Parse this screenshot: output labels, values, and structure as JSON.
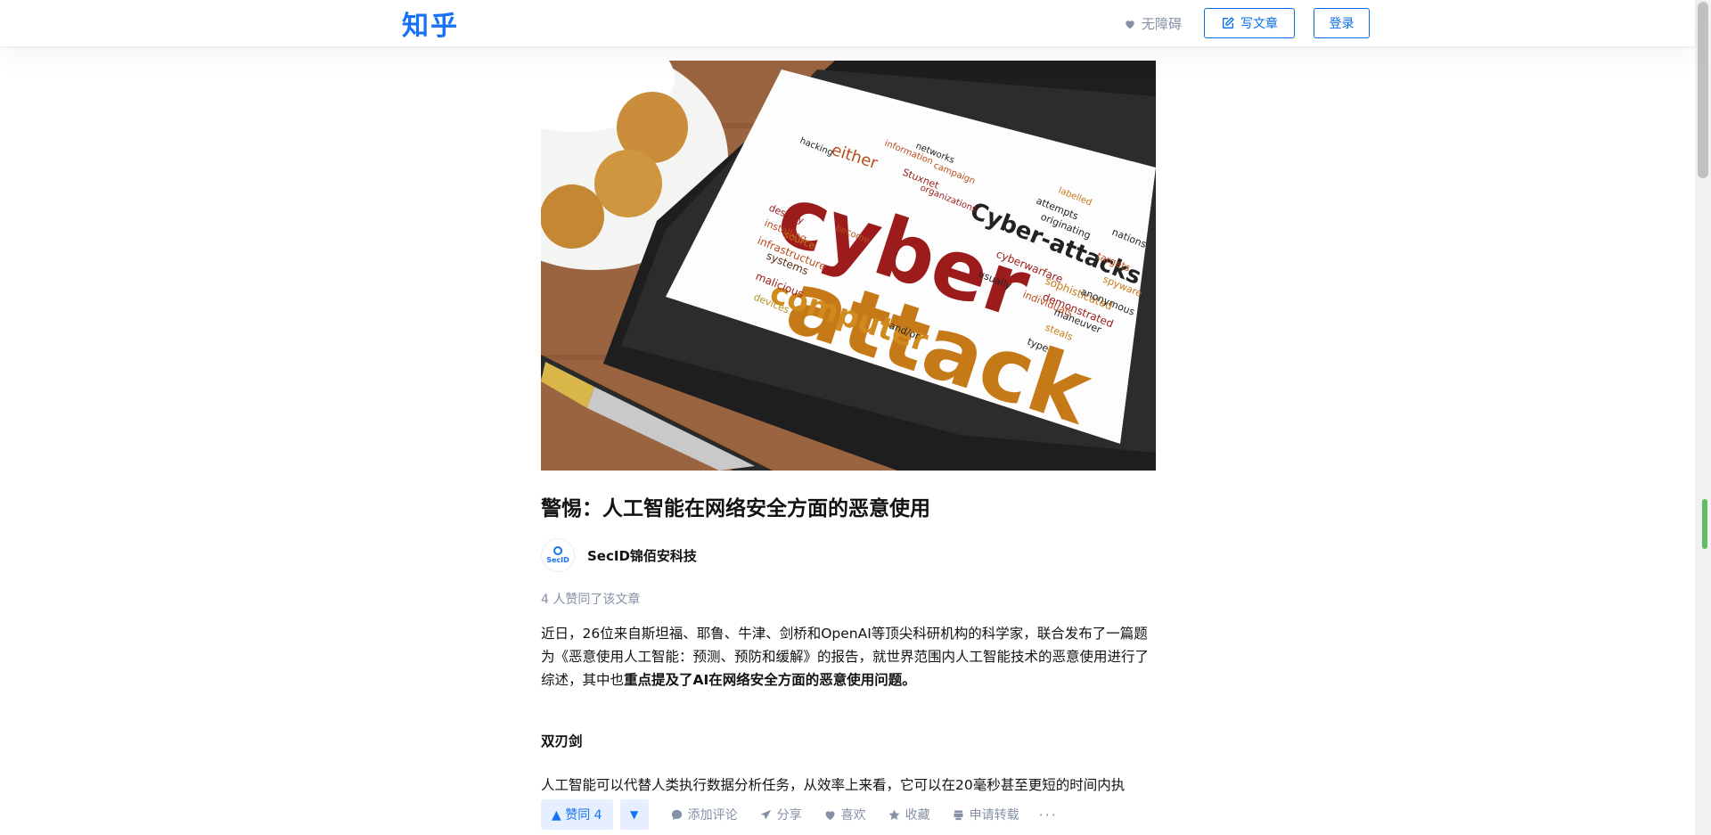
{
  "header": {
    "logo": "知乎",
    "accessibility": "无障碍",
    "write_label": "写文章",
    "login_label": "登录"
  },
  "article": {
    "image_words": {
      "main1": "cyber",
      "main2": "attack",
      "w_computer": "computer",
      "w_cyberattacks": "Cyber-attacks",
      "w_either": "either",
      "w_malicious": "malicious",
      "w_devices": "devices",
      "w_systems": "systems",
      "w_infrastructure": "infrastructure",
      "w_cyberwarfare": "cyberwarfare",
      "w_sophisticated": "sophisticated",
      "w_demonstrated": "demonstrated",
      "w_anonymous": "anonymous",
      "w_spyware": "spyware",
      "w_targets": "targets",
      "w_nations": "nations",
      "w_steals": "steals",
      "w_type": "type",
      "w_andor": "and/or",
      "w_usually": "usually",
      "w_hacking": "hacking",
      "w_information": "information",
      "w_networks": "networks",
      "w_destroy": "destroy",
      "w_installing": "installing",
      "w_maneuver": "maneuver",
      "w_individuals": "individuals",
      "w_attempts": "attempts",
      "w_originating": "originating",
      "w_labelled": "labelled",
      "w_campaign": "campaign",
      "w_stuxnet": "Stuxnet",
      "w_organizations": "organizations",
      "w_become": "become",
      "w_source": "source"
    },
    "title": "警惕：人工智能在网络安全方面的恶意使用",
    "author_name": "SecID锦佰安科技",
    "avatar_text": "SecID",
    "votes_line": "4 人赞同了该文章",
    "para1_normal": "近日，26位来自斯坦福、耶鲁、牛津、剑桥和OpenAI等顶尖科研机构的科学家，联合发布了一篇题为《恶意使用人工智能：预测、预防和缓解》的报告，就世界范围内人工智能技术的恶意使用进行了综述，其中也",
    "para1_bold": "重点提及了AI在网络安全方面的恶意使用问题。",
    "heading2": "双刃剑",
    "para2": "人工智能可以代替人类执行数据分析任务，从效率上来看，它可以在20毫秒甚至更短的时间内执"
  },
  "actions": {
    "upvote": "▲ 赞同 4",
    "downvote": "▼",
    "comment": "添加评论",
    "share": "分享",
    "like": "喜欢",
    "favorite": "收藏",
    "repost": "申请转载",
    "more": "···"
  }
}
